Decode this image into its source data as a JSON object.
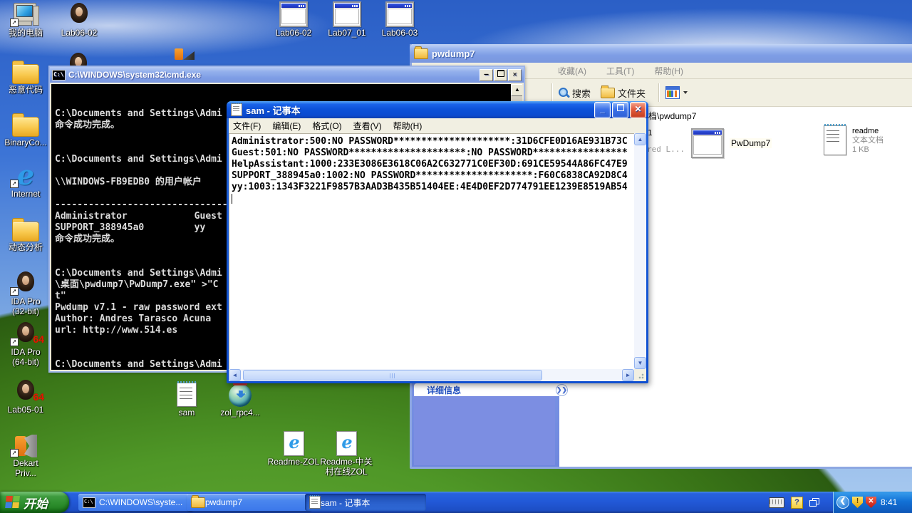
{
  "desktop": {
    "icons": {
      "my_computer": "我的电脑",
      "lab06_02": "Lab06-02",
      "malicious_code": "恶意代码",
      "binaryco": "BinaryCo...",
      "internet": "Internet",
      "dynamic_analysis": "动态分析",
      "ida32_l1": "IDA Pro",
      "ida32_l2": "(32-bit)",
      "ida64_l1": "IDA Pro",
      "ida64_l2": "(64-bit)",
      "lab05_01": "Lab05-01",
      "dekart_l1": "Dekart",
      "dekart_l2": "Priv...",
      "top_lab06_02": "Lab06-02",
      "top_lab07_01": "Lab07_01",
      "top_lab06_03": "Lab06-03",
      "sam": "sam",
      "zol": "zol_rpc4...",
      "readme_zol": "Readme-ZOL",
      "readme_zgc_l1": "Readme-中关",
      "readme_zgc_l2": "村在线ZOL"
    }
  },
  "cmd": {
    "title": "C:\\WINDOWS\\system32\\cmd.exe",
    "lines": [
      "C:\\Documents and Settings\\Admi",
      "命令成功完成。",
      "C:\\Documents and Settings\\Admi",
      "\\\\WINDOWS-FB9EDB0 的用户帐户",
      "----------------------------------------------------",
      "Administrator            Guest",
      "SUPPORT_388945a0         yy",
      "命令成功完成。",
      "C:\\Documents and Settings\\Admi",
      "\\桌面\\pwdump7\\PwDump7.exe\" >\"C",
      "t\"",
      "Pwdump v7.1 - raw password ext",
      "Author: Andres Tarasco Acuna",
      "url: http://www.514.es",
      "C:\\Documents and Settings\\Admi"
    ]
  },
  "notepad": {
    "title": "sam - 记事本",
    "menu": [
      "文件(F)",
      "编辑(E)",
      "格式(O)",
      "查看(V)",
      "帮助(H)"
    ],
    "lines": [
      "Administrator:500:NO PASSWORD*********************:31D6CFE0D16AE931B73C",
      "Guest:501:NO PASSWORD*********************:NO PASSWORD*****************",
      "HelpAssistant:1000:233E3086E3618C06A2C632771C0EF30D:691CE59544A86FC47E9",
      "SUPPORT_388945a0:1002:NO PASSWORD*********************:F60C6838CA92D8C4",
      "yy:1003:1343F3221F9857B3AAD3B435B51404EE:4E4D0EF2D774791EE1239E8519AB54"
    ]
  },
  "explorer": {
    "title": "pwdump7",
    "menu": [
      "收藏(A)",
      "工具(T)",
      "帮助(H)"
    ],
    "toolbar_search": "搜索",
    "toolbar_folders": "文件夹",
    "address_fragment": "档\\pwdump7",
    "content_fragment_1": "1",
    "content_fragment_2": "red L...",
    "item_pwdump7": "PwDump7",
    "item_readme_name": "readme",
    "item_readme_type": "文本文档",
    "item_readme_size": "1 KB",
    "details_header": "详细信息"
  },
  "taskbar": {
    "start": "开始",
    "btn_cmd": "C:\\WINDOWS\\syste...",
    "btn_pwdump7": "pwdump7",
    "btn_sam": "sam - 记事本",
    "clock": "8:41"
  }
}
